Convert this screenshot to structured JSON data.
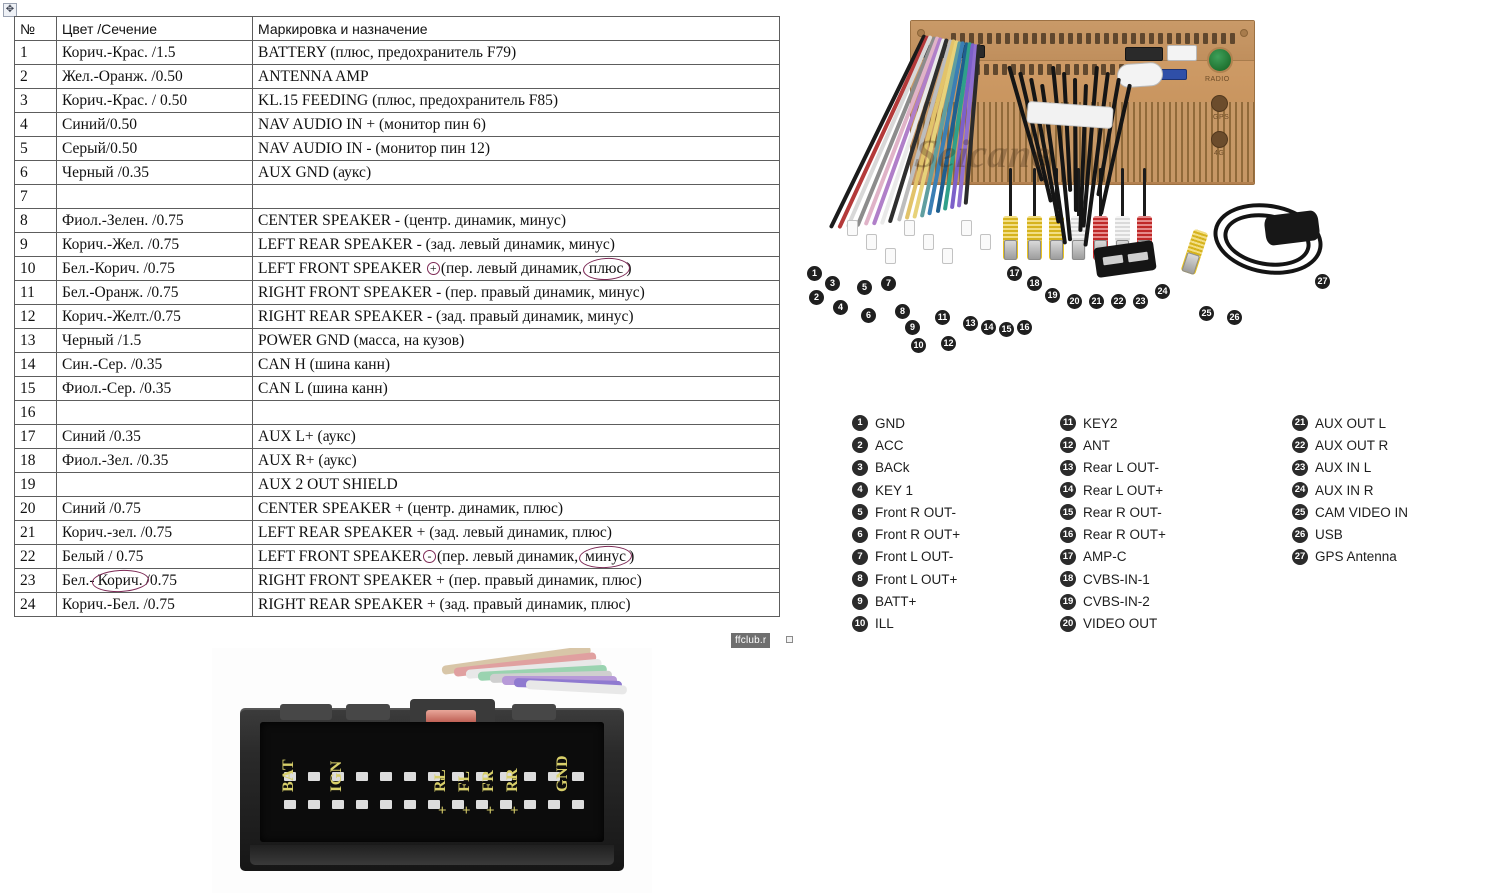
{
  "document": {
    "move_handle_icon": "move-handle-icon",
    "table_resize_nub": "table-resize-handle"
  },
  "pinout_table": {
    "headers": [
      "№",
      "Цвет /Сечение",
      "Маркировка и назначение"
    ],
    "rows": [
      {
        "num": "1",
        "color": "Корич.-Крас. /1.5",
        "marking": "BATTERY (плюс, предохранитель F79)"
      },
      {
        "num": "2",
        "color": "Жел.-Оранж. /0.50",
        "marking": "ANTENNA AMP"
      },
      {
        "num": "3",
        "color": "Корич.-Крас. / 0.50",
        "marking": "KL.15 FEEDING (плюс, предохранитель F85)"
      },
      {
        "num": "4",
        "color": "Синий/0.50",
        "marking": "NAV AUDIO IN + (монитор пин 6)"
      },
      {
        "num": "5",
        "color": "Серый/0.50",
        "marking": "NAV AUDIO IN - (монитор пин 12)"
      },
      {
        "num": "6",
        "color": "Черный /0.35",
        "marking": "AUX GND (аукс)"
      },
      {
        "num": "7",
        "color": "",
        "marking": ""
      },
      {
        "num": "8",
        "color": "Фиол.-Зелен. /0.75",
        "marking": "CENTER SPEAKER - (центр. динамик, минус)"
      },
      {
        "num": "9",
        "color": "Корич.-Жел. /0.75",
        "marking": "LEFT REAR SPEAKER - (зад. левый динамик, минус)"
      },
      {
        "num": "10",
        "color": "Бел.-Корич. /0.75",
        "marking_pre": "LEFT FRONT SPEAKER ",
        "marking_sym": "+",
        "marking_mid": "(пер. левый динамик, ",
        "marking_circled": "плюс",
        "marking_post": ")"
      },
      {
        "num": "11",
        "color": "Бел.-Оранж. /0.75",
        "marking": "RIGHT FRONT SPEAKER - (пер. правый динамик, минус)"
      },
      {
        "num": "12",
        "color": "Корич.-Желт./0.75",
        "marking": "RIGHT REAR SPEAKER - (зад. правый динамик, минус)"
      },
      {
        "num": "13",
        "color": "Черный /1.5",
        "marking": "POWER GND (масса, на кузов)"
      },
      {
        "num": "14",
        "color": "Син.-Сер. /0.35",
        "marking": "CAN H (шина канн)"
      },
      {
        "num": "15",
        "color": "Фиол.-Сер. /0.35",
        "marking": "CAN L (шина канн)"
      },
      {
        "num": "16",
        "color": "",
        "marking": ""
      },
      {
        "num": "17",
        "color": "Синий /0.35",
        "marking": "AUX L+ (аукс)"
      },
      {
        "num": "18",
        "color": "Фиол.-Зел. /0.35",
        "marking": "AUX R+ (аукс)"
      },
      {
        "num": "19",
        "color": "",
        "marking": "AUX 2 OUT SHIELD"
      },
      {
        "num": "20",
        "color": "Синий /0.75",
        "marking": "CENTER SPEAKER + (центр. динамик, плюс)"
      },
      {
        "num": "21",
        "color": "Корич.-зел. /0.75",
        "marking": "LEFT REAR SPEAKER + (зад. левый динамик, плюс)"
      },
      {
        "num": "22",
        "color": "Белый / 0.75",
        "marking_pre": "LEFT FRONT SPEAKER",
        "marking_sym": "-",
        "marking_mid": "(пер. левый динамик, ",
        "marking_circled": "минус",
        "marking_post": ")"
      },
      {
        "num": "23",
        "color_pre": "Бел.-",
        "color_circled": "Корич.",
        "color_post": "/0.75",
        "marking": "RIGHT FRONT SPEAKER + (пер. правый динамик, плюс)"
      },
      {
        "num": "24",
        "color": "Корич.-Бел. /0.75",
        "marking": "RIGHT REAR SPEAKER + (зад. правый динамик, плюс)"
      }
    ]
  },
  "watermarks": {
    "photo": "Seicane",
    "table": "ffclub.r"
  },
  "head_unit_photo": {
    "jack_labels": [
      "RADIO",
      "GPS",
      "4G"
    ],
    "callouts": [
      "1",
      "2",
      "3",
      "4",
      "5",
      "6",
      "7",
      "8",
      "9",
      "10",
      "11",
      "12",
      "13",
      "14",
      "15",
      "16",
      "17",
      "18",
      "19",
      "20",
      "21",
      "22",
      "23",
      "24",
      "25",
      "26",
      "27"
    ]
  },
  "pin_legend": {
    "columns": [
      [
        {
          "num": "1",
          "label": "GND"
        },
        {
          "num": "2",
          "label": "ACC"
        },
        {
          "num": "3",
          "label": "BACk"
        },
        {
          "num": "4",
          "label": "KEY 1"
        },
        {
          "num": "5",
          "label": "Front R OUT-"
        },
        {
          "num": "6",
          "label": "Front R OUT+"
        },
        {
          "num": "7",
          "label": "Front L OUT-"
        },
        {
          "num": "8",
          "label": "Front L OUT+"
        },
        {
          "num": "9",
          "label": "BATT+"
        },
        {
          "num": "10",
          "label": "ILL"
        }
      ],
      [
        {
          "num": "11",
          "label": "KEY2"
        },
        {
          "num": "12",
          "label": "ANT"
        },
        {
          "num": "13",
          "label": "Rear L OUT-"
        },
        {
          "num": "14",
          "label": "Rear L OUT+"
        },
        {
          "num": "15",
          "label": "Rear R OUT-"
        },
        {
          "num": "16",
          "label": "Rear R OUT+"
        },
        {
          "num": "17",
          "label": "AMP-C"
        },
        {
          "num": "18",
          "label": "CVBS-IN-1"
        },
        {
          "num": "19",
          "label": "CVBS-IN-2"
        },
        {
          "num": "20",
          "label": "VIDEO OUT"
        }
      ],
      [
        {
          "num": "21",
          "label": "AUX OUT L"
        },
        {
          "num": "22",
          "label": "AUX OUT R"
        },
        {
          "num": "23",
          "label": "AUX IN L"
        },
        {
          "num": "24",
          "label": "AUX IN R"
        },
        {
          "num": "25",
          "label": "CAM VIDEO IN"
        },
        {
          "num": "26",
          "label": "USB"
        },
        {
          "num": "27",
          "label": "GPS Antenna"
        }
      ]
    ]
  },
  "connector_photo": {
    "labels": [
      "BAT",
      "IGN",
      "RL",
      "FL",
      "FR",
      "RR",
      "GND"
    ],
    "minus_signs": [
      "-",
      "-",
      "-",
      "-"
    ],
    "plus_signs": [
      "+",
      "+",
      "+",
      "+"
    ]
  },
  "colors": {
    "table_border": "#5d5d5d",
    "circle_annotation": "#7d2a56",
    "legend_badge": "#2b2b2b",
    "connector_label": "#d8cf6a",
    "chassis": "#c8945e"
  }
}
